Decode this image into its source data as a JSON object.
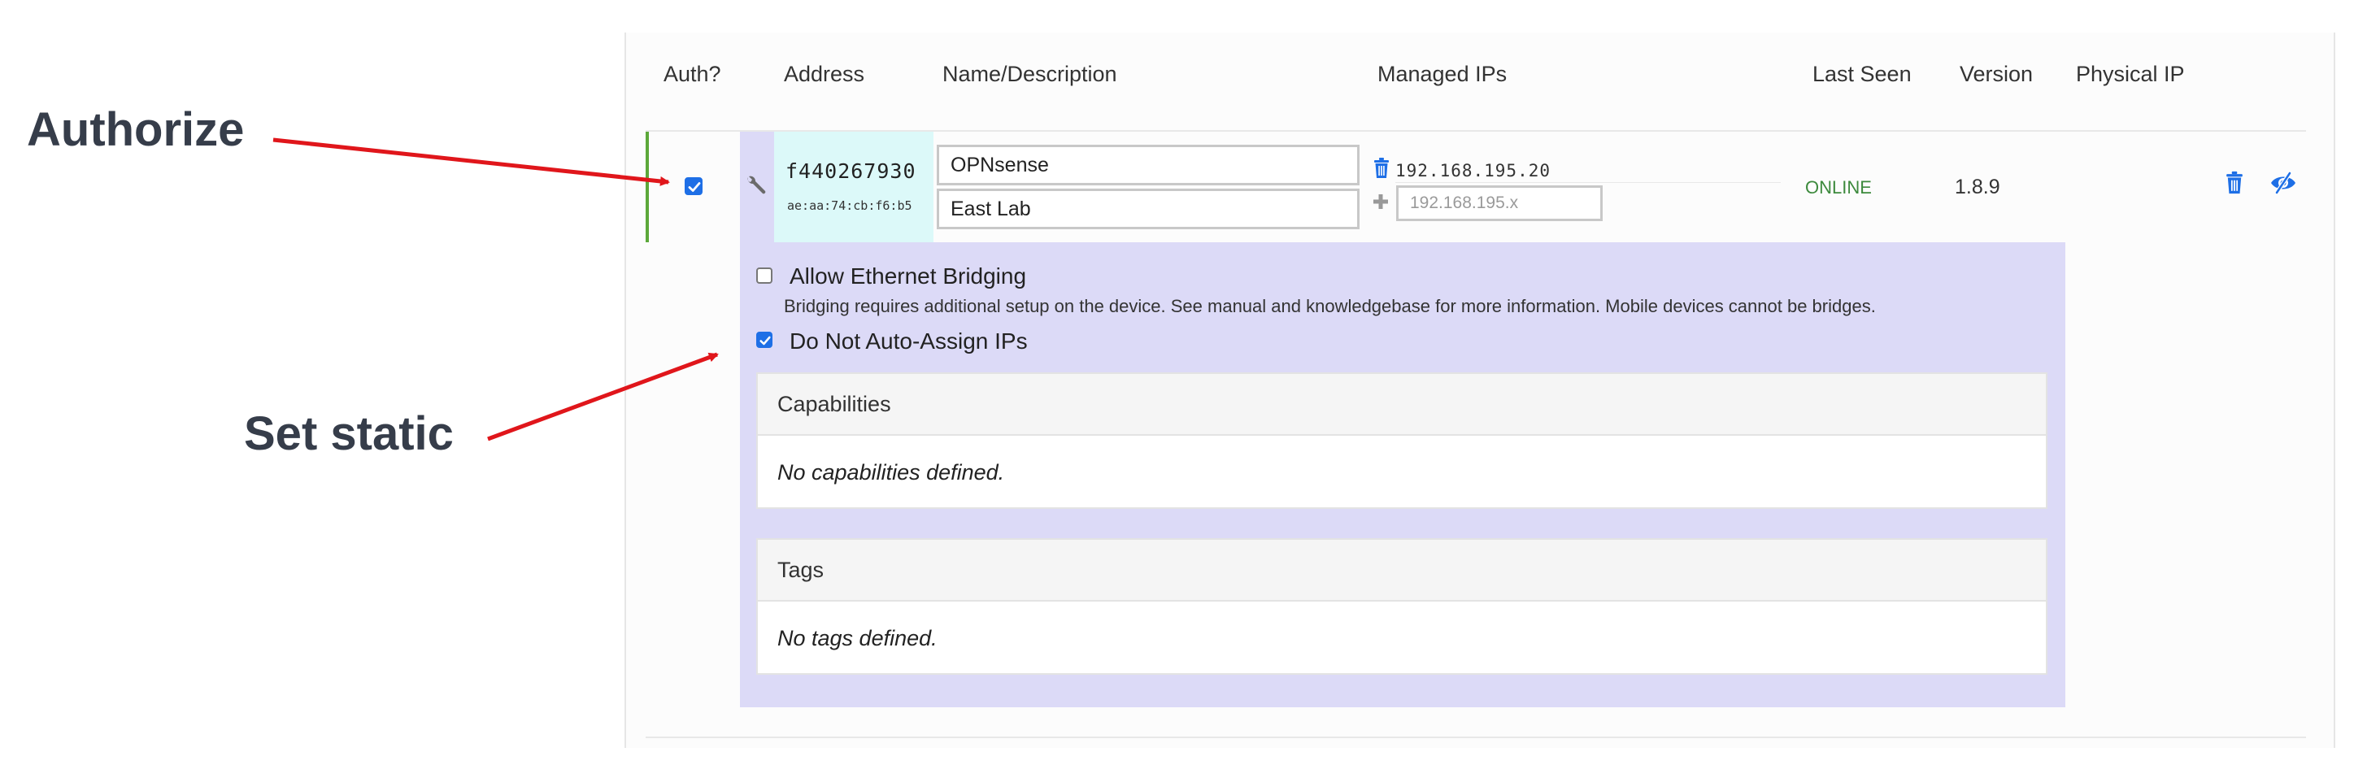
{
  "annotations": {
    "authorize": "Authorize",
    "set_static": "Set static"
  },
  "table": {
    "headers": {
      "auth": "Auth?",
      "address": "Address",
      "name": "Name/Description",
      "managed_ips": "Managed IPs",
      "last_seen": "Last Seen",
      "version": "Version",
      "physical_ip": "Physical IP"
    },
    "row": {
      "authorized": true,
      "address": "f440267930",
      "mac": "ae:aa:74:cb:f6:b5",
      "name_value": "OPNsense",
      "description_value": "East Lab",
      "managed_ip": "192.168.195.20",
      "new_ip_placeholder": "192.168.195.x",
      "last_seen": "ONLINE",
      "version": "1.8.9",
      "physical_ip": ""
    }
  },
  "details": {
    "bridging_label": "Allow Ethernet Bridging",
    "bridging_checked": false,
    "bridging_help": "Bridging requires additional setup on the device. See manual and knowledgebase for more information. Mobile devices cannot be bridges.",
    "no_auto_assign_label": "Do Not Auto-Assign IPs",
    "no_auto_assign_checked": true,
    "capabilities_title": "Capabilities",
    "capabilities_empty": "No capabilities defined.",
    "tags_title": "Tags",
    "tags_empty": "No tags defined."
  },
  "icons": {
    "wrench": "wrench-icon",
    "trash": "trash-icon",
    "plus": "plus-icon",
    "hide": "eye-slash-icon"
  },
  "colors": {
    "accent_blue": "#1e6fe6",
    "online_green": "#3d8a3d",
    "row_accent": "#5ca83a",
    "expand_bg": "#dcdaf7",
    "address_bg": "#dcf9f9",
    "arrow_red": "#e0161b",
    "annotation_text": "#363d4a"
  }
}
